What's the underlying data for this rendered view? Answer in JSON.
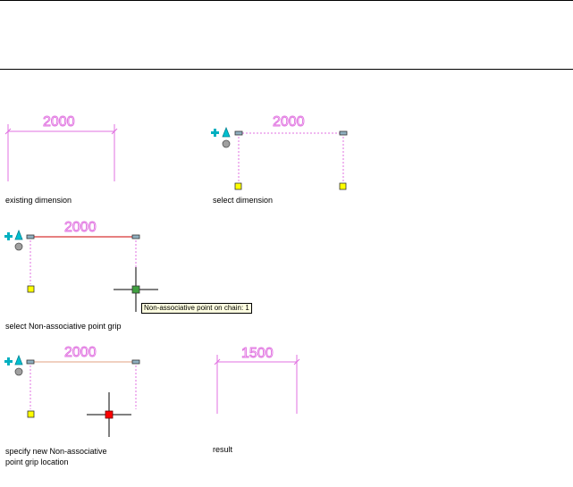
{
  "captions": {
    "existing": "existing dimension",
    "select": "select dimension",
    "select_grip": "select Non-associative point grip",
    "specify_line1": "specify new Non-associative",
    "specify_line2": "point grip location",
    "result": "result"
  },
  "tooltip": "Non-associative point on chain: 1",
  "dimensions": {
    "existing": "2000",
    "selected": "2000",
    "grip_selected": "2000",
    "specify": "2000",
    "result": "1500"
  },
  "colors": {
    "dimension": "#e070e0",
    "selected_dimension_line": "#cc0000",
    "grip": "#ffff00",
    "grip_hot": "#ff0000",
    "grip_hover": "#40a040",
    "cursor": "#000000",
    "menu_plus": "#00b0c0",
    "menu_triangle": "#00c0d0"
  },
  "icons": [
    "plus-icon",
    "triangle-icon",
    "circle-icon",
    "grip-icon",
    "crosshair-icon"
  ]
}
